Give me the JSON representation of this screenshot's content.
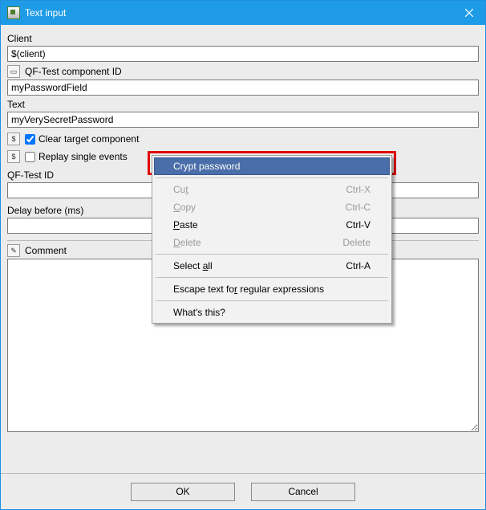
{
  "window": {
    "title": "Text input"
  },
  "labels": {
    "client": "Client",
    "component": "QF-Test component ID",
    "text": "Text",
    "clear_target": "Clear target component",
    "replay_single": "Replay single events",
    "qftest_id": "QF-Test ID",
    "delay": "Delay before (ms)",
    "comment": "Comment"
  },
  "fields": {
    "client": "$(client)",
    "component": "myPasswordField",
    "text": "myVerySecretPassword",
    "qftest_id": "",
    "delay": "",
    "comment": ""
  },
  "checks": {
    "clear_target": true,
    "replay_single": false
  },
  "menu": {
    "crypt": "Crypt password",
    "cut": "Cut",
    "cut_key": "Ctrl-X",
    "copy": "Copy",
    "copy_key": "Ctrl-C",
    "paste": "Paste",
    "paste_key": "Ctrl-V",
    "delete": "Delete",
    "delete_key": "Delete",
    "select_all": "Select all",
    "select_all_key": "Ctrl-A",
    "escape": "Escape text for regular expressions",
    "whats_this": "What's this?"
  },
  "buttons": {
    "ok": "OK",
    "cancel": "Cancel"
  }
}
